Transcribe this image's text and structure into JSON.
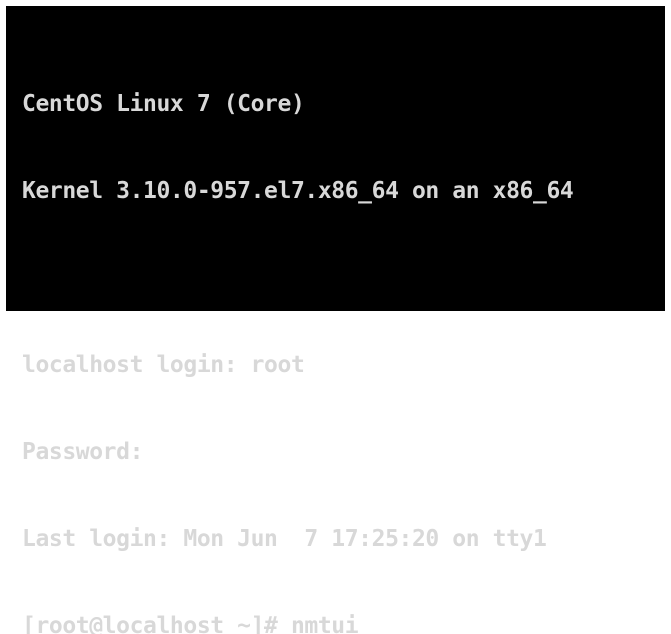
{
  "console": {
    "lines": [
      "CentOS Linux 7 (Core)",
      "Kernel 3.10.0-957.el7.x86_64 on an x86_64",
      "",
      "localhost login: root",
      "Password:",
      "Last login: Mon Jun  7 17:25:20 on tty1",
      "[root@localhost ~]# nmtui"
    ]
  },
  "colors": {
    "background": "#000000",
    "text": "#d8d8d8",
    "border": "#ffffff"
  }
}
